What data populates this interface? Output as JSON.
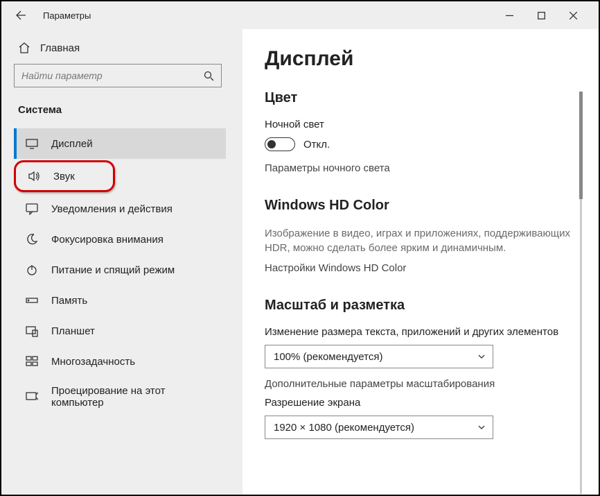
{
  "window": {
    "title": "Параметры"
  },
  "sidebar": {
    "home": "Главная",
    "search_placeholder": "Найти параметр",
    "category": "Система",
    "items": [
      {
        "label": "Дисплей"
      },
      {
        "label": "Звук"
      },
      {
        "label": "Уведомления и действия"
      },
      {
        "label": "Фокусировка внимания"
      },
      {
        "label": "Питание и спящий режим"
      },
      {
        "label": "Память"
      },
      {
        "label": "Планшет"
      },
      {
        "label": "Многозадачность"
      },
      {
        "label": "Проецирование на этот компьютер"
      }
    ]
  },
  "main": {
    "page_title": "Дисплей",
    "color": {
      "heading": "Цвет",
      "night_light_label": "Ночной свет",
      "toggle_state": "Откл.",
      "night_light_settings": "Параметры ночного света"
    },
    "hd": {
      "heading": "Windows HD Color",
      "desc": "Изображение в видео, играх и приложениях, поддерживающих HDR, можно сделать более ярким и динамичным.",
      "link": "Настройки Windows HD Color"
    },
    "scale": {
      "heading": "Масштаб и разметка",
      "scale_label": "Изменение размера текста, приложений и других элементов",
      "scale_value": "100% (рекомендуется)",
      "advanced_link": "Дополнительные параметры масштабирования",
      "resolution_label": "Разрешение экрана",
      "resolution_value": "1920 × 1080 (рекомендуется)"
    }
  }
}
